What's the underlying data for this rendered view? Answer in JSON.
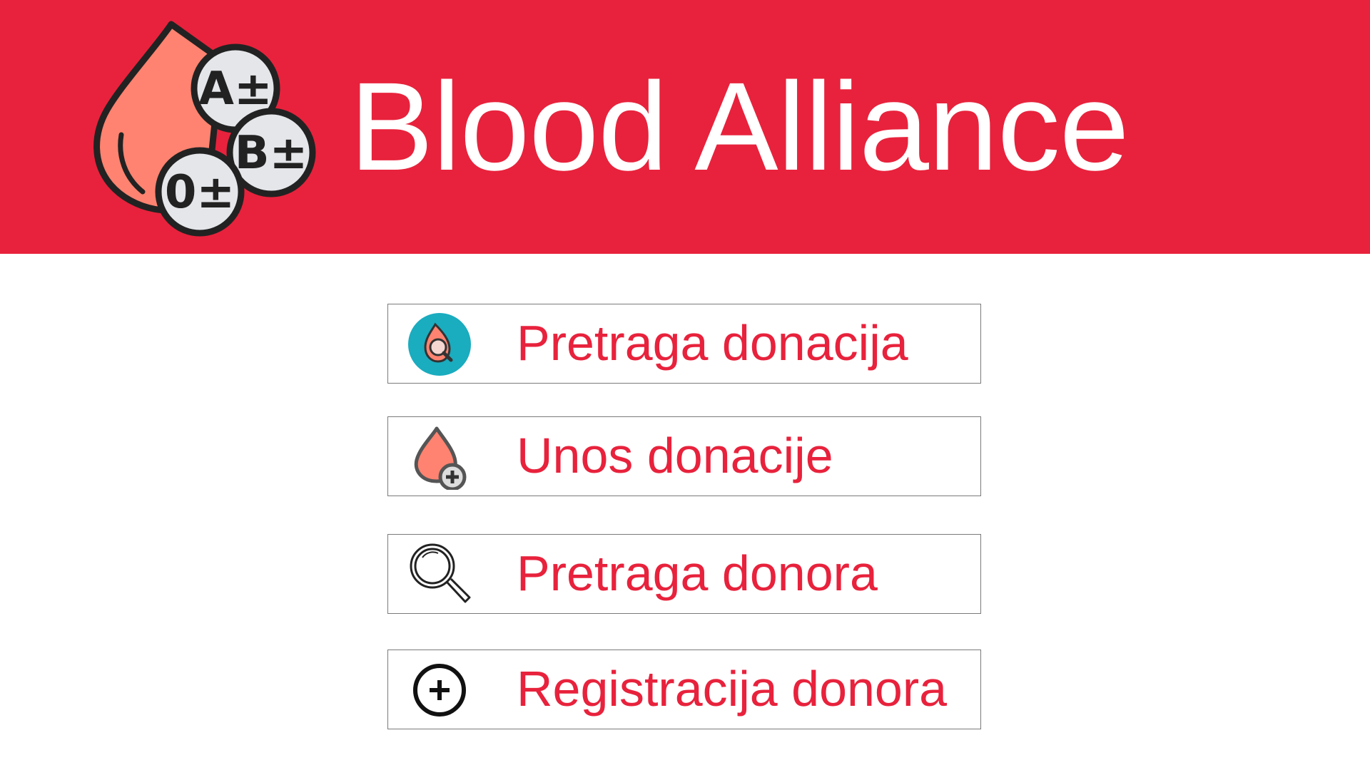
{
  "app": {
    "title": "Blood Alliance",
    "logo_blood_types": [
      "A±",
      "B±",
      "0±"
    ]
  },
  "colors": {
    "brand_red": "#e8223c",
    "drop_salmon": "#ff8370",
    "teal": "#1aacbf"
  },
  "menu": {
    "items": [
      {
        "label": "Pretraga donacija",
        "icon": "blood-search-icon"
      },
      {
        "label": "Unos donacije",
        "icon": "blood-add-icon"
      },
      {
        "label": "Pretraga donora",
        "icon": "magnifier-icon"
      },
      {
        "label": "Registracija donora",
        "icon": "plus-circle-icon"
      }
    ]
  }
}
